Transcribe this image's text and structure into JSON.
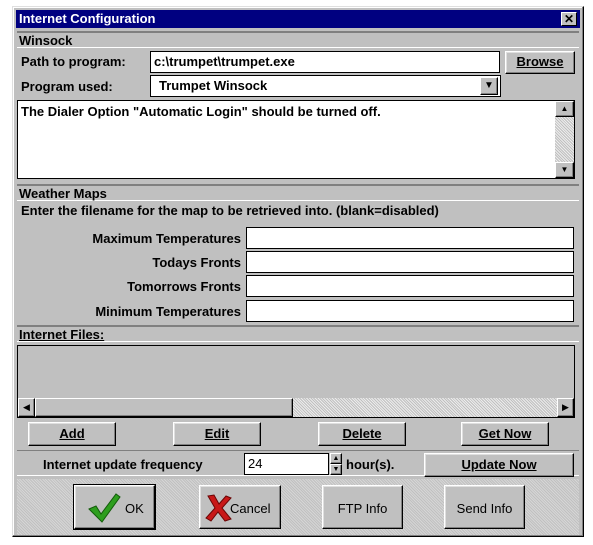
{
  "window": {
    "title": "Internet Configuration",
    "close_glyph": "✕"
  },
  "winsock": {
    "section_title": "Winsock",
    "path_label": "Path to program:",
    "path_value": "c:\\trumpet\\trumpet.exe",
    "browse_label": "Browse",
    "program_label": "Program used:",
    "program_value": "Trumpet Winsock",
    "note_text": "The Dialer Option \"Automatic Login\" should be turned off."
  },
  "weather": {
    "section_title": "Weather Maps",
    "instruction": "Enter the filename for the map to be retrieved into. (blank=disabled)",
    "maps": [
      {
        "label": "Maximum Temperatures",
        "value": ""
      },
      {
        "label": "Todays Fronts",
        "value": ""
      },
      {
        "label": "Tomorrows Fronts",
        "value": ""
      },
      {
        "label": "Minimum Temperatures",
        "value": ""
      }
    ]
  },
  "internet_files": {
    "section_title": "Internet Files:",
    "buttons": {
      "add": "Add",
      "edit": "Edit",
      "delete": "Delete",
      "get_now": "Get Now"
    }
  },
  "update": {
    "label": "Internet update frequency",
    "value": "24",
    "unit": "hour(s).",
    "update_now": "Update Now"
  },
  "footer_buttons": {
    "ok": "OK",
    "cancel": "Cancel",
    "ftp_info": "FTP Info",
    "send_info": "Send Info"
  },
  "colors": {
    "title_bar": "#000080",
    "face": "#c0c0c0",
    "checkmark": "#2e9e1e",
    "cancel_x": "#c81818"
  }
}
